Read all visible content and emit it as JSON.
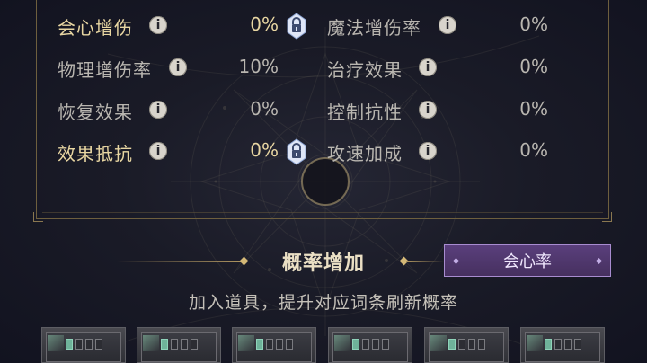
{
  "stats": {
    "left": [
      {
        "label": "会心增伤",
        "value": "0%",
        "highlight": true
      },
      {
        "label": "物理增伤率",
        "value": "10%",
        "highlight": false
      },
      {
        "label": "恢复效果",
        "value": "0%",
        "highlight": false
      },
      {
        "label": "效果抵抗",
        "value": "0%",
        "highlight": true
      }
    ],
    "right": [
      {
        "label": "魔法增伤率",
        "value": "0%"
      },
      {
        "label": "治疗效果",
        "value": "0%"
      },
      {
        "label": "控制抗性",
        "value": "0%"
      },
      {
        "label": "攻速加成",
        "value": "0%"
      }
    ],
    "info_icon": "i",
    "icons": {
      "info": "info-icon",
      "lock": "lock-icon"
    }
  },
  "probability": {
    "title": "概率增加",
    "button_label": "会心率",
    "description": "加入道具，提升对应词条刷新概率"
  },
  "item_slots": [
    {
      "filled_pips": 1,
      "total_pips": 4
    },
    {
      "filled_pips": 1,
      "total_pips": 4
    },
    {
      "filled_pips": 1,
      "total_pips": 4
    },
    {
      "filled_pips": 1,
      "total_pips": 4
    },
    {
      "filled_pips": 1,
      "total_pips": 4
    },
    {
      "filled_pips": 1,
      "total_pips": 4
    }
  ],
  "colors": {
    "highlight_text": "#e8d6a2",
    "normal_text": "#b9b6b0",
    "button_bg": "#5a3f7c",
    "gold_line": "#b09660"
  }
}
